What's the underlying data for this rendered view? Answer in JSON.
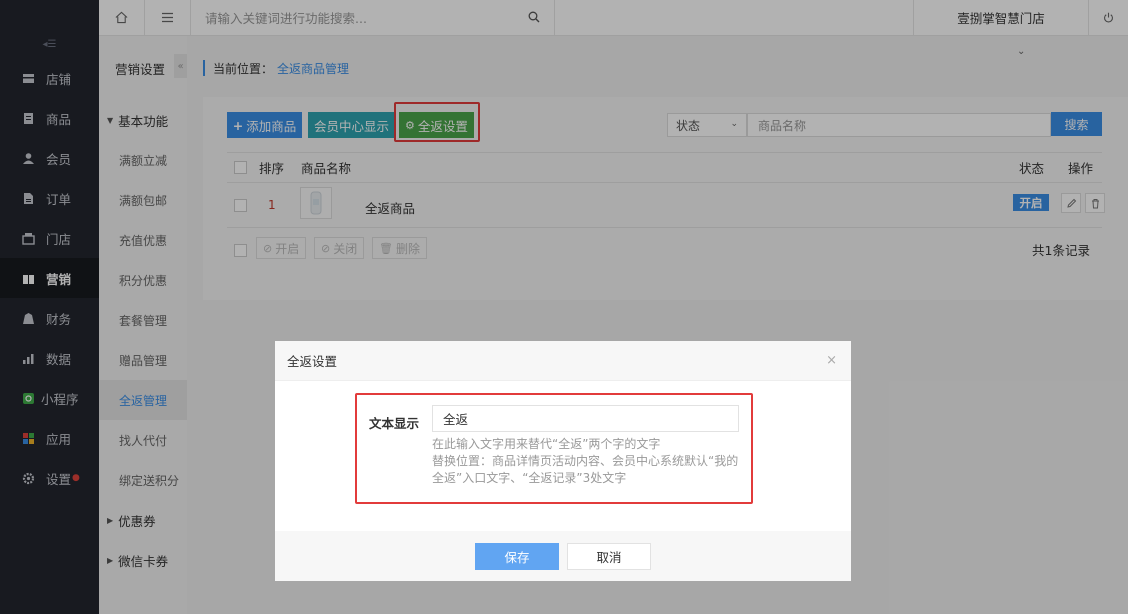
{
  "topbar": {
    "search_placeholder": "请输入关键词进行功能搜索...",
    "store_name": "壹捌掌智慧门店"
  },
  "sidebar": {
    "items": [
      {
        "label": "店铺",
        "icon": "store-icon"
      },
      {
        "label": "商品",
        "icon": "goods-icon"
      },
      {
        "label": "会员",
        "icon": "member-icon"
      },
      {
        "label": "订单",
        "icon": "order-icon"
      },
      {
        "label": "门店",
        "icon": "shop-icon"
      },
      {
        "label": "营销",
        "icon": "marketing-icon",
        "active": true
      },
      {
        "label": "财务",
        "icon": "finance-icon"
      },
      {
        "label": "数据",
        "icon": "data-icon"
      },
      {
        "label": "小程序",
        "icon": "miniprogram-icon"
      },
      {
        "label": "应用",
        "icon": "apps-icon"
      },
      {
        "label": "设置",
        "icon": "settings-icon",
        "badge_dot": true
      }
    ]
  },
  "subnav": {
    "title": "营销设置",
    "group_basic": "基本功能",
    "items": [
      "满额立减",
      "满额包邮",
      "充值优惠",
      "积分优惠",
      "套餐管理",
      "赠品管理",
      "全返管理",
      "找人代付",
      "绑定送积分"
    ],
    "active_index": 6,
    "group_coupon": "优惠券",
    "group_wechat": "微信卡券"
  },
  "breadcrumb": {
    "prefix": "当前位置：",
    "current": "全返商品管理"
  },
  "toolbar": {
    "add_label": "添加商品",
    "member_label": "会员中心显示",
    "setting_label": "全返设置",
    "status_select": "状态",
    "name_placeholder": "商品名称",
    "search_label": "搜索"
  },
  "table": {
    "headers": {
      "sort": "排序",
      "name": "商品名称",
      "status": "状态",
      "op": "操作"
    },
    "rows": [
      {
        "sort": "1",
        "name": "全返商品",
        "status": "开启"
      }
    ],
    "bulk": {
      "enable": "开启",
      "disable": "关闭",
      "delete": "删除"
    },
    "total": "共1条记录"
  },
  "dialog": {
    "title": "全返设置",
    "field_label": "文本显示",
    "field_value": "全返",
    "help_line1": "在此输入文字用来替代“全返”两个字的文字",
    "help_line2": "替换位置：商品详情页活动内容、会员中心系统默认“我的全返”入口文字、“全返记录”3处文字",
    "save_label": "保存",
    "cancel_label": "取消"
  },
  "colors": {
    "primary": "#3a8ee6",
    "member_btn": "#2fa4b0",
    "setting_btn": "#4ba54b",
    "highlight": "#e23b3b",
    "sidebar_bg": "#23262e"
  }
}
